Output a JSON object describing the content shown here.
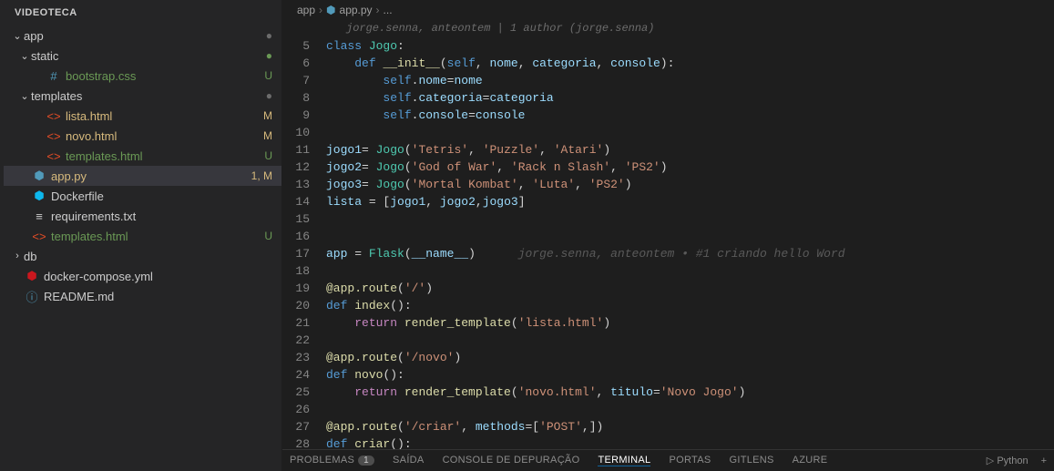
{
  "sidebar": {
    "title": "VIDEOTECA",
    "items": [
      {
        "label": "app",
        "type": "folder",
        "expanded": true,
        "indent": 0,
        "badge": "●",
        "badgeClass": "dot"
      },
      {
        "label": "static",
        "type": "folder",
        "expanded": true,
        "indent": 1,
        "badge": "●",
        "badgeClass": "dot untracked"
      },
      {
        "label": "bootstrap.css",
        "type": "file",
        "icon": "#",
        "iconClass": "ic-css",
        "indent": 2,
        "badge": "U",
        "status": "untracked"
      },
      {
        "label": "templates",
        "type": "folder",
        "expanded": true,
        "indent": 1,
        "badge": "●",
        "badgeClass": "dot"
      },
      {
        "label": "lista.html",
        "type": "file",
        "icon": "<>",
        "iconClass": "ic-html",
        "indent": 2,
        "badge": "M",
        "status": "modified"
      },
      {
        "label": "novo.html",
        "type": "file",
        "icon": "<>",
        "iconClass": "ic-html",
        "indent": 2,
        "badge": "M",
        "status": "modified"
      },
      {
        "label": "templates.html",
        "type": "file",
        "icon": "<>",
        "iconClass": "ic-html",
        "indent": 2,
        "badge": "U",
        "status": "untracked"
      },
      {
        "label": "app.py",
        "type": "file",
        "icon": "⬢",
        "iconClass": "ic-py",
        "indent": 1,
        "badge": "1, M",
        "status": "modified",
        "active": true
      },
      {
        "label": "Dockerfile",
        "type": "file",
        "icon": "⬢",
        "iconClass": "ic-docker",
        "indent": 1
      },
      {
        "label": "requirements.txt",
        "type": "file",
        "icon": "≡",
        "iconClass": "ic-txt",
        "indent": 1
      },
      {
        "label": "templates.html",
        "type": "file",
        "icon": "<>",
        "iconClass": "ic-html",
        "indent": 1,
        "badge": "U",
        "status": "untracked"
      },
      {
        "label": "db",
        "type": "folder",
        "expanded": false,
        "indent": 0
      },
      {
        "label": "docker-compose.yml",
        "type": "file",
        "icon": "⬢",
        "iconClass": "ic-yml",
        "indent": 0
      },
      {
        "label": "README.md",
        "type": "file",
        "icon": "ⓘ",
        "iconClass": "ic-md",
        "indent": 0
      }
    ]
  },
  "breadcrumb": {
    "parts": [
      "app",
      "app.py",
      "..."
    ]
  },
  "editor": {
    "authorship": "jorge.senna, anteontem | 1 author (jorge.senna)",
    "blame": "jorge.senna, anteontem • #1 criando hello Word",
    "lines": [
      {
        "n": 5,
        "html": "<span class='kw'>class</span> <span class='cls'>Jogo</span><span class='punc'>:</span>"
      },
      {
        "n": 6,
        "html": "    <span class='kw'>def</span> <span class='fn'>__init__</span><span class='punc'>(</span><span class='self'>self</span><span class='punc'>, </span><span class='var'>nome</span><span class='punc'>, </span><span class='var'>categoria</span><span class='punc'>, </span><span class='var'>console</span><span class='punc'>):</span>"
      },
      {
        "n": 7,
        "html": "        <span class='self'>self</span><span class='punc'>.</span><span class='prop'>nome</span><span class='punc'>=</span><span class='var'>nome</span>"
      },
      {
        "n": 8,
        "html": "        <span class='self'>self</span><span class='punc'>.</span><span class='prop'>categoria</span><span class='punc'>=</span><span class='var'>categoria</span>"
      },
      {
        "n": 9,
        "html": "        <span class='self'>self</span><span class='punc'>.</span><span class='prop'>console</span><span class='punc'>=</span><span class='var'>console</span>"
      },
      {
        "n": 10,
        "html": ""
      },
      {
        "n": 11,
        "html": "<span class='var'>jogo1</span><span class='punc'>= </span><span class='cls'>Jogo</span><span class='punc'>(</span><span class='str'>'Tetris'</span><span class='punc'>, </span><span class='str'>'Puzzle'</span><span class='punc'>, </span><span class='str'>'Atari'</span><span class='punc'>)</span>"
      },
      {
        "n": 12,
        "html": "<span class='var'>jogo2</span><span class='punc'>= </span><span class='cls'>Jogo</span><span class='punc'>(</span><span class='str'>'God of War'</span><span class='punc'>, </span><span class='str'>'Rack n Slash'</span><span class='punc'>, </span><span class='str'>'PS2'</span><span class='punc'>)</span>"
      },
      {
        "n": 13,
        "html": "<span class='var'>jogo3</span><span class='punc'>= </span><span class='cls'>Jogo</span><span class='punc'>(</span><span class='str'>'Mortal Kombat'</span><span class='punc'>, </span><span class='str'>'Luta'</span><span class='punc'>, </span><span class='str'>'PS2'</span><span class='punc'>)</span>"
      },
      {
        "n": 14,
        "html": "<span class='var'>lista</span> <span class='punc'>= [</span><span class='var'>jogo1</span><span class='punc'>, </span><span class='var'>jogo2</span><span class='punc'>,</span><span class='var'>jogo3</span><span class='punc'>]</span>"
      },
      {
        "n": 15,
        "html": ""
      },
      {
        "n": 16,
        "html": ""
      },
      {
        "n": 17,
        "html": "<span class='var'>app</span> <span class='punc'>= </span><span class='cls'>Flask</span><span class='punc'>(</span><span class='var'>__name__</span><span class='punc'>)</span>      <span class='blame' data-name='git-blame-annotation'>jorge.senna, anteontem • #1 criando hello Word</span>"
      },
      {
        "n": 18,
        "html": ""
      },
      {
        "n": 19,
        "html": "<span class='dec'>@app.route</span><span class='punc'>(</span><span class='str'>'/'</span><span class='punc'>)</span>"
      },
      {
        "n": 20,
        "html": "<span class='kw'>def</span> <span class='fn'>index</span><span class='punc'>():</span>"
      },
      {
        "n": 21,
        "html": "    <span class='kw2'>return</span> <span class='fn'>render_template</span><span class='punc'>(</span><span class='str'>'lista.html'</span><span class='punc'>)</span>"
      },
      {
        "n": 22,
        "html": ""
      },
      {
        "n": 23,
        "html": "<span class='dec'>@app.route</span><span class='punc'>(</span><span class='str'>'/novo'</span><span class='punc'>)</span>"
      },
      {
        "n": 24,
        "html": "<span class='kw'>def</span> <span class='fn'>novo</span><span class='punc'>():</span>"
      },
      {
        "n": 25,
        "html": "    <span class='kw2'>return</span> <span class='fn'>render_template</span><span class='punc'>(</span><span class='str'>'novo.html'</span><span class='punc'>, </span><span class='var'>titulo</span><span class='punc'>=</span><span class='str'>'Novo Jogo'</span><span class='punc'>)</span>"
      },
      {
        "n": 26,
        "html": ""
      },
      {
        "n": 27,
        "html": "<span class='dec'>@app.route</span><span class='punc'>(</span><span class='str'>'/criar'</span><span class='punc'>, </span><span class='var'>methods</span><span class='punc'>=[</span><span class='str'>'POST'</span><span class='punc'>,])</span>"
      },
      {
        "n": 28,
        "html": "<span class='kw'>def</span> <span class='fn'>criar</span><span class='punc'>():</span>"
      }
    ]
  },
  "bottomPanel": {
    "tabs": [
      {
        "label": "PROBLEMAS",
        "count": "1"
      },
      {
        "label": "SAÍDA"
      },
      {
        "label": "CONSOLE DE DEPURAÇÃO"
      },
      {
        "label": "TERMINAL",
        "active": true
      },
      {
        "label": "PORTAS"
      },
      {
        "label": "GITLENS"
      },
      {
        "label": "AZURE"
      }
    ],
    "right": {
      "shell": "Python"
    }
  }
}
